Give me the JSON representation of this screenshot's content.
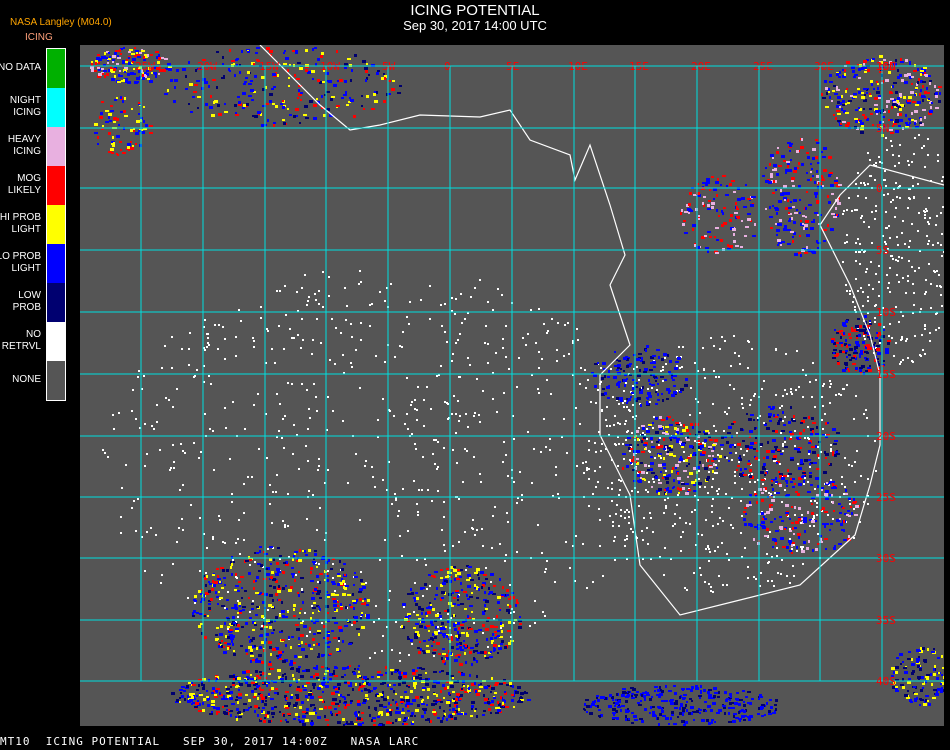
{
  "header": {
    "title": "ICING POTENTIAL",
    "subtitle": "Sep 30, 2017 14:00 UTC",
    "org": "NASA Langley (M04.0)",
    "product": "ICING"
  },
  "legend": [
    {
      "label": "NO DATA",
      "color": "#00b000"
    },
    {
      "label": "NIGHT\nICING",
      "color": "#00ffff"
    },
    {
      "label": "HEAVY\nICING",
      "color": "#e8b0e0"
    },
    {
      "label": "MOG\nLIKELY",
      "color": "#ff0000"
    },
    {
      "label": "HI PROB\nLIGHT",
      "color": "#ffff00"
    },
    {
      "label": "LO PROB\nLIGHT",
      "color": "#0000ff"
    },
    {
      "label": "LOW\nPROB",
      "color": "#000070"
    },
    {
      "label": "NO\nRETRVL",
      "color": "#ffffff"
    },
    {
      "label": "NONE",
      "color": "#555555"
    }
  ],
  "map": {
    "background": "#555555",
    "grid_color": "#00e0e0",
    "label_color": "#ff0000",
    "lon_labels": [
      "25W",
      "20W",
      "15W",
      "10W",
      "5W",
      "0",
      "5E",
      "10E",
      "15E",
      "20E",
      "25E",
      "30E",
      "35E"
    ],
    "lat_labels": [
      "10N",
      "5N",
      "0",
      "5S",
      "10S",
      "15S",
      "20S",
      "25S",
      "30S",
      "35S",
      "40S"
    ]
  },
  "footer": {
    "text": "MT10  ICING POTENTIAL   SEP 30, 2017 14:00Z   NASA LARC"
  }
}
